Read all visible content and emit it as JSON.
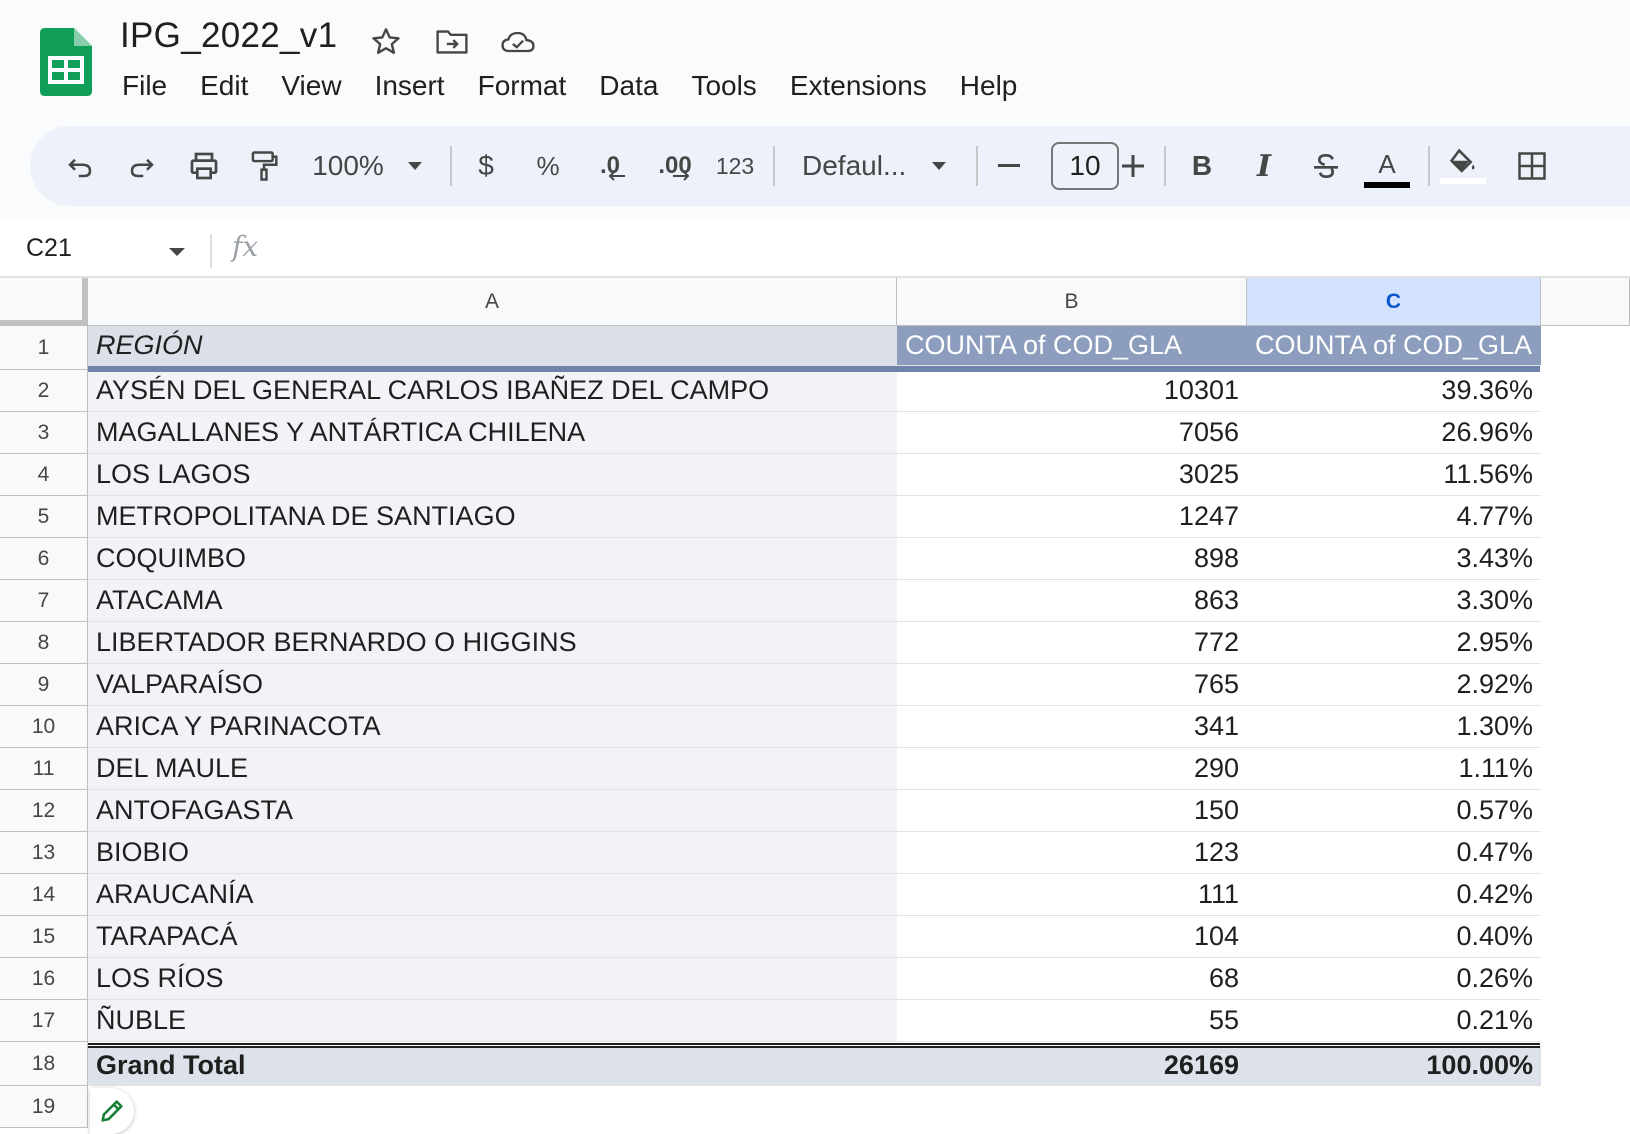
{
  "document": {
    "title": "IPG_2022_v1",
    "brand_color": "#0f9d58"
  },
  "menu": [
    "File",
    "Edit",
    "View",
    "Insert",
    "Format",
    "Data",
    "Tools",
    "Extensions",
    "Help"
  ],
  "toolbar": {
    "zoom": "100%",
    "currency_label": "$",
    "percent_label": "%",
    "decrease_decimals_label": ".0",
    "increase_decimals_label": ".00",
    "number_format_label": "123",
    "font_name": "Defaul...",
    "font_size": "10",
    "text_color": "#000000"
  },
  "formula_bar": {
    "cell_ref": "C21",
    "fx_label": "fx",
    "value": ""
  },
  "columns": [
    "A",
    "B",
    "C"
  ],
  "selected_column": "C",
  "table": {
    "headers": [
      "REGIÓN",
      "COUNTA of COD_GLA",
      "COUNTA of COD_GLA"
    ],
    "rows": [
      {
        "row": "2",
        "region": "AYSÉN DEL GENERAL CARLOS IBAÑEZ DEL CAMPO",
        "count": "10301",
        "percent": "39.36%"
      },
      {
        "row": "3",
        "region": "MAGALLANES Y ANTÁRTICA CHILENA",
        "count": "7056",
        "percent": "26.96%"
      },
      {
        "row": "4",
        "region": "LOS LAGOS",
        "count": "3025",
        "percent": "11.56%"
      },
      {
        "row": "5",
        "region": "METROPOLITANA DE SANTIAGO",
        "count": "1247",
        "percent": "4.77%"
      },
      {
        "row": "6",
        "region": "COQUIMBO",
        "count": "898",
        "percent": "3.43%"
      },
      {
        "row": "7",
        "region": "ATACAMA",
        "count": "863",
        "percent": "3.30%"
      },
      {
        "row": "8",
        "region": "LIBERTADOR BERNARDO O HIGGINS",
        "count": "772",
        "percent": "2.95%"
      },
      {
        "row": "9",
        "region": "VALPARAÍSO",
        "count": "765",
        "percent": "2.92%"
      },
      {
        "row": "10",
        "region": "ARICA Y PARINACOTA",
        "count": "341",
        "percent": "1.30%"
      },
      {
        "row": "11",
        "region": "DEL MAULE",
        "count": "290",
        "percent": "1.11%"
      },
      {
        "row": "12",
        "region": "ANTOFAGASTA",
        "count": "150",
        "percent": "0.57%"
      },
      {
        "row": "13",
        "region": "BIOBIO",
        "count": "123",
        "percent": "0.47%"
      },
      {
        "row": "14",
        "region": "ARAUCANÍA",
        "count": "111",
        "percent": "0.42%"
      },
      {
        "row": "15",
        "region": "TARAPACÁ",
        "count": "104",
        "percent": "0.40%"
      },
      {
        "row": "16",
        "region": "LOS RÍOS",
        "count": "68",
        "percent": "0.26%"
      },
      {
        "row": "17",
        "region": "ÑUBLE",
        "count": "55",
        "percent": "0.21%"
      }
    ],
    "total": {
      "row": "18",
      "label": "Grand Total",
      "count": "26169",
      "percent": "100.00%"
    }
  },
  "row_numbers": [
    "1",
    "19"
  ]
}
